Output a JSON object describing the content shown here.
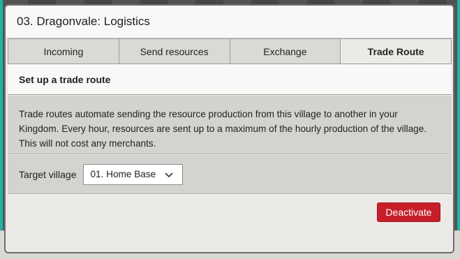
{
  "dialog": {
    "title": "03. Dragonvale: Logistics"
  },
  "tabs": [
    {
      "label": "Incoming",
      "active": false
    },
    {
      "label": "Send resources",
      "active": false
    },
    {
      "label": "Exchange",
      "active": false
    },
    {
      "label": "Trade Route",
      "active": true
    }
  ],
  "section": {
    "title": "Set up a trade route"
  },
  "description": {
    "line1": "Trade routes automate sending the resource production from this village to another in your",
    "line2": "Kingdom. Every hour, resources are sent up to a maximum of the hourly production of the village.",
    "line3": "This will not cost any merchants."
  },
  "target": {
    "label": "Target village",
    "selected": "01. Home Base"
  },
  "actions": {
    "deactivate_label": "Deactivate"
  },
  "colors": {
    "accent_red": "#c61f2a",
    "teal_edge": "#1fb3a8"
  }
}
